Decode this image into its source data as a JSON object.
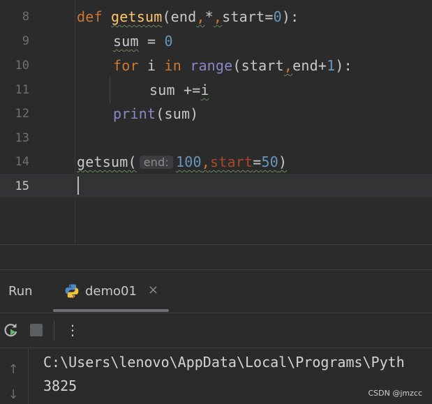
{
  "editor": {
    "line_numbers": [
      "8",
      "9",
      "10",
      "11",
      "12",
      "13",
      "14",
      "15"
    ],
    "line8": {
      "kw_def": "def",
      "fn_name": "getsum",
      "p1": "(end",
      "c1": ",",
      "star": "*",
      "c2": ",",
      "p2": "start=",
      "n0": "0",
      "p3": "):"
    },
    "line9": {
      "var": "sum",
      "op": " = ",
      "n0": "0"
    },
    "line10": {
      "kw_for": "for",
      "i": " i ",
      "kw_in": "in",
      "sp": " ",
      "range": "range",
      "p1": "(start",
      "c1": ",",
      "p2": "end+",
      "n1": "1",
      "p3": "):"
    },
    "line11": {
      "stmt": "sum +=",
      "i": "i"
    },
    "line12": {
      "print": "print",
      "args": "(sum)"
    },
    "line14": {
      "call": "getsum(",
      "inlay_hint": "end:",
      "n100": "100",
      "comma": ",",
      "kw_start": "start",
      "eq": "=",
      "n50": "50",
      "close": ")"
    }
  },
  "run_panel": {
    "title": "Run",
    "tab_label": "demo01",
    "tab_close": "×",
    "more_menu": "⋮"
  },
  "console": {
    "up_arrow": "↑",
    "down_arrow": "↓",
    "path_line": "C:\\Users\\lenovo\\AppData\\Local\\Programs\\Pyth",
    "result_line": "3825"
  },
  "watermark": "CSDN @jmzcc",
  "icons": [
    "python-icon",
    "rerun-icon",
    "stop-icon",
    "more-icon",
    "close-icon",
    "up-arrow-icon",
    "down-arrow-icon"
  ],
  "colors": {
    "keyword": "#cc7832",
    "function": "#ffc66d",
    "number": "#6897bb",
    "builtin": "#8888c6",
    "named_arg": "#aa4926",
    "background": "#2b2b2b"
  }
}
